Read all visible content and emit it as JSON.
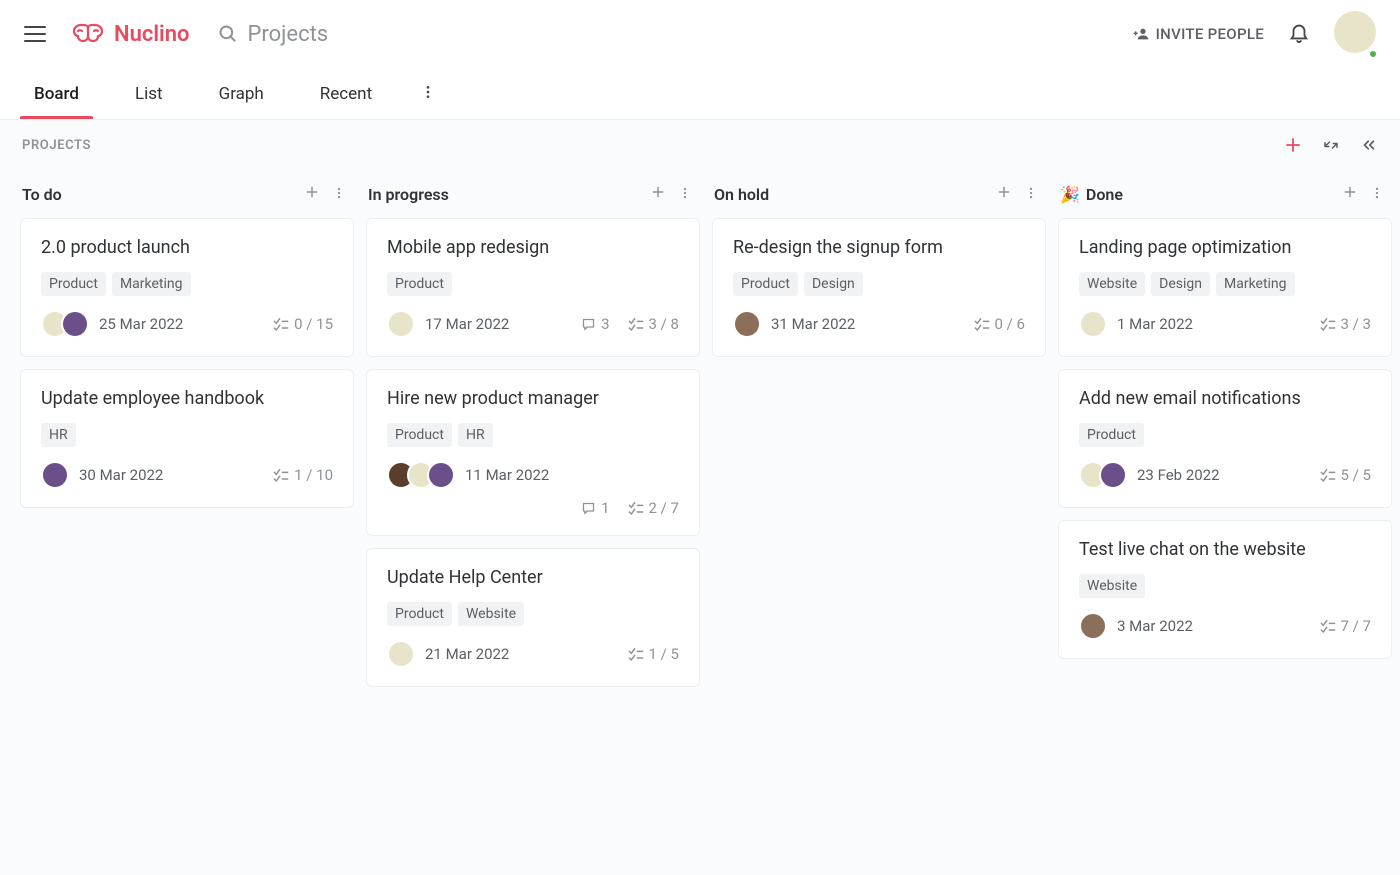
{
  "app": {
    "name": "Nuclino"
  },
  "search": {
    "placeholder": "Projects"
  },
  "header": {
    "invite_label": "INVITE PEOPLE"
  },
  "tabs": [
    {
      "label": "Board",
      "active": true
    },
    {
      "label": "List",
      "active": false
    },
    {
      "label": "Graph",
      "active": false
    },
    {
      "label": "Recent",
      "active": false
    }
  ],
  "breadcrumb": "PROJECTS",
  "columns": [
    {
      "title": "To do",
      "icon": "",
      "cards": [
        {
          "title": "2.0 product launch",
          "tags": [
            "Product",
            "Marketing"
          ],
          "avatars": [
            "#e8e4c9",
            "#6b4f8a"
          ],
          "date": "25 Mar 2022",
          "comments": null,
          "tasks": "0 / 15"
        },
        {
          "title": "Update employee handbook",
          "tags": [
            "HR"
          ],
          "avatars": [
            "#6b4f8a"
          ],
          "date": "30 Mar 2022",
          "comments": null,
          "tasks": "1 / 10"
        }
      ]
    },
    {
      "title": "In progress",
      "icon": "",
      "cards": [
        {
          "title": "Mobile app redesign",
          "tags": [
            "Product"
          ],
          "avatars": [
            "#e8e4c9"
          ],
          "date": "17 Mar 2022",
          "comments": "3",
          "tasks": "3 / 8"
        },
        {
          "title": "Hire new product manager",
          "tags": [
            "Product",
            "HR"
          ],
          "avatars": [
            "#5a3d2b",
            "#e8e4c9",
            "#6b4f8a"
          ],
          "date": "11 Mar 2022",
          "comments": "1",
          "tasks": "2 / 7",
          "two_line": true
        },
        {
          "title": "Update Help Center",
          "tags": [
            "Product",
            "Website"
          ],
          "avatars": [
            "#e8e4c9"
          ],
          "date": "21 Mar 2022",
          "comments": null,
          "tasks": "1 / 5"
        }
      ]
    },
    {
      "title": "On hold",
      "icon": "",
      "cards": [
        {
          "title": "Re-design the signup form",
          "tags": [
            "Product",
            "Design"
          ],
          "avatars": [
            "#8b6f5a"
          ],
          "date": "31 Mar 2022",
          "comments": null,
          "tasks": "0 / 6"
        }
      ]
    },
    {
      "title": "Done",
      "icon": "🎉",
      "cards": [
        {
          "title": "Landing page optimization",
          "tags": [
            "Website",
            "Design",
            "Marketing"
          ],
          "avatars": [
            "#e8e4c9"
          ],
          "date": "1 Mar 2022",
          "comments": null,
          "tasks": "3 / 3"
        },
        {
          "title": "Add new email notifications",
          "tags": [
            "Product"
          ],
          "avatars": [
            "#e8e4c9",
            "#6b4f8a"
          ],
          "date": "23 Feb 2022",
          "comments": null,
          "tasks": "5 / 5"
        },
        {
          "title": "Test live chat on the website",
          "tags": [
            "Website"
          ],
          "avatars": [
            "#8b6f5a"
          ],
          "date": "3 Mar 2022",
          "comments": null,
          "tasks": "7 / 7"
        }
      ]
    }
  ]
}
